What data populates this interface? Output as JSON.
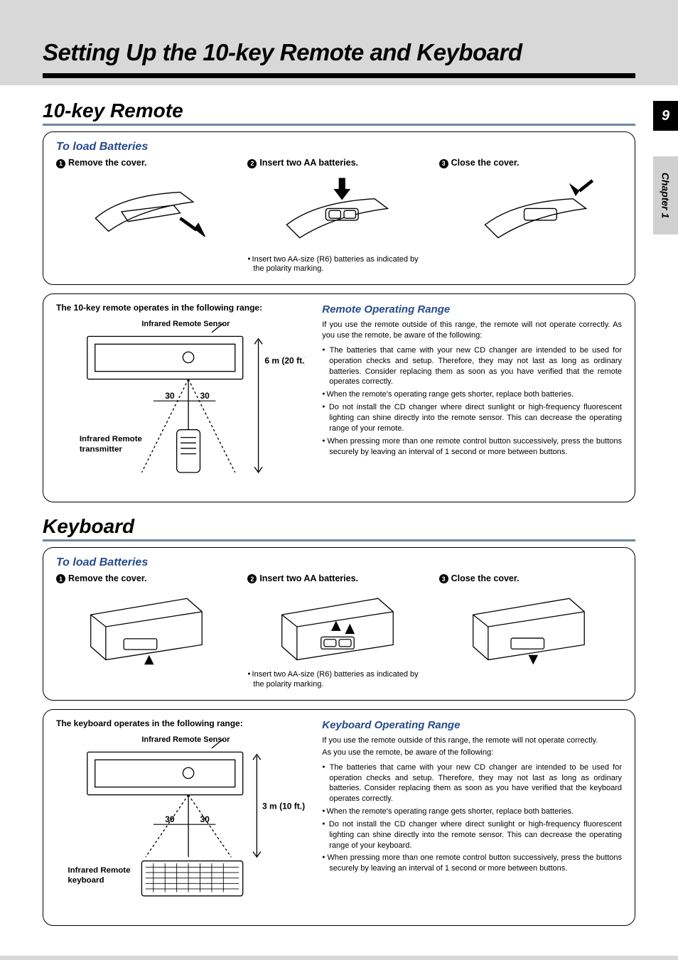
{
  "page_number": "9",
  "chapter_tab": "Chapter 1",
  "page_title": "Setting Up the 10-key Remote and Keyboard",
  "remote": {
    "section_heading": "10-key Remote",
    "load_title": "To load Batteries",
    "steps": {
      "s1": "Remove the cover.",
      "s2": "Insert two AA batteries.",
      "s2_note": "Insert two AA-size (R6) batteries as indicated by the polarity marking.",
      "s3": "Close the cover."
    },
    "range_box": {
      "heading": "The 10-key remote operates in the following range:",
      "sensor_label": "Infrared Remote Sensor",
      "transmitter_label": "Infrared Remote transmitter",
      "distance": "6 m (20 ft.)",
      "angle_left": "30",
      "angle_right": "30",
      "op_title": "Remote Operating Range",
      "intro": "If you use the remote outside of this range, the remote will not operate correctly. As you use the remote, be aware of the following:",
      "bullets": {
        "b1": "The batteries that came with your new CD changer are intended to be used for operation checks and setup. Therefore, they may not last as long as ordinary batteries. Consider replacing them as soon as you have verified that the remote operates correctly.",
        "b2": "When the remote's operating range gets shorter, replace both batteries.",
        "b3": "Do not install the CD changer where direct sunlight or high-frequency fluorescent lighting can shine directly into the remote sensor. This can decrease the operating range of your remote.",
        "b4": "When pressing more than one remote control button successively, press the buttons securely by leaving an interval of 1 second or more between buttons."
      }
    }
  },
  "keyboard": {
    "section_heading": "Keyboard",
    "load_title": "To load Batteries",
    "steps": {
      "s1": "Remove the cover.",
      "s2": "Insert two AA batteries.",
      "s2_note": "Insert two AA-size (R6) batteries as indicated by the polarity marking.",
      "s3": "Close the cover."
    },
    "range_box": {
      "heading": "The keyboard operates in the following range:",
      "sensor_label": "Infrared Remote Sensor",
      "transmitter_label": "Infrared Remote keyboard",
      "distance": "3 m (10 ft.)",
      "angle_left": "30",
      "angle_right": "30",
      "op_title": "Keyboard Operating Range",
      "intro1": "If you use the remote outside of this range, the remote will not operate correctly.",
      "intro2": "As you use the remote, be aware of the following:",
      "bullets": {
        "b1": "The batteries that came with your new CD changer are intended to be used for operation checks and setup. Therefore, they may not last as long as ordinary batteries. Consider replacing them as soon as you have verified that the keyboard operates correctly.",
        "b2": "When the remote's operating range gets shorter, replace both batteries.",
        "b3": "Do not install the CD changer where direct sunlight or high-frequency fluorescent lighting can shine directly into the remote sensor. This can decrease the operating range of your keyboard.",
        "b4": "When pressing more than one remote control button successively, press the buttons securely by leaving an interval of 1 second or more between buttons."
      }
    }
  }
}
